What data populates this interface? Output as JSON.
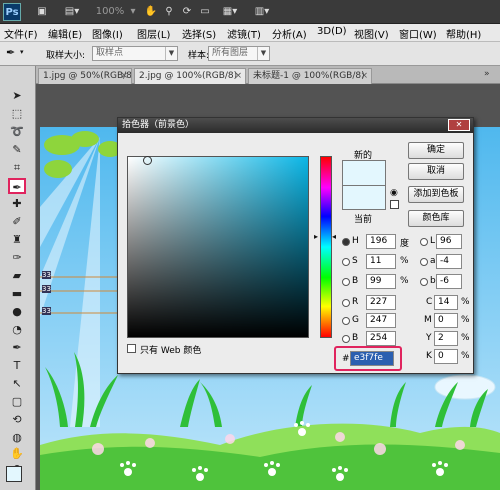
{
  "app": {
    "logo": "Ps",
    "zoom": "100%"
  },
  "menu": [
    "文件(F)",
    "编辑(E)",
    "图像(I)",
    "图层(L)",
    "选择(S)",
    "滤镜(T)",
    "分析(A)",
    "3D(D)",
    "视图(V)",
    "窗口(W)",
    "帮助(H)"
  ],
  "options": {
    "sample_size_label": "取样大小:",
    "sample_size_value": "取样点",
    "sample_label": "样本:",
    "sample_value": "所有图层"
  },
  "tabs": [
    {
      "label": "1.jpg @ 50%(RGB/8)"
    },
    {
      "label": "2.jpg @ 100%(RGB/8)"
    },
    {
      "label": "未标题-1 @ 100%(RGB/8)"
    }
  ],
  "canvas": {
    "ruler_marks": [
      "33",
      "33",
      "33"
    ]
  },
  "dialog": {
    "title": "拾色器（前景色）",
    "new_label": "新的",
    "current_label": "当前",
    "new_color": "#e8f7fe",
    "current_color": "#e8f7fe",
    "buttons": {
      "ok": "确定",
      "cancel": "取消",
      "add_swatch": "添加到色板",
      "libraries": "颜色库"
    },
    "only_web_label": "只有 Web 颜色",
    "hsb": [
      {
        "key": "H",
        "value": "196",
        "unit": "度"
      },
      {
        "key": "S",
        "value": "11",
        "unit": "%"
      },
      {
        "key": "B",
        "value": "99",
        "unit": "%"
      }
    ],
    "rgb": [
      {
        "key": "R",
        "value": "227"
      },
      {
        "key": "G",
        "value": "247"
      },
      {
        "key": "B",
        "value": "254"
      }
    ],
    "lab": [
      {
        "key": "L",
        "value": "96"
      },
      {
        "key": "a",
        "value": "-4"
      },
      {
        "key": "b",
        "value": "-6"
      }
    ],
    "cmyk": [
      {
        "key": "C",
        "value": "14",
        "unit": "%"
      },
      {
        "key": "M",
        "value": "0",
        "unit": "%"
      },
      {
        "key": "Y",
        "value": "2",
        "unit": "%"
      },
      {
        "key": "K",
        "value": "0",
        "unit": "%"
      }
    ],
    "hex_prefix": "#",
    "hex": "e3f7fe",
    "highlight_color": "#e0245e"
  }
}
